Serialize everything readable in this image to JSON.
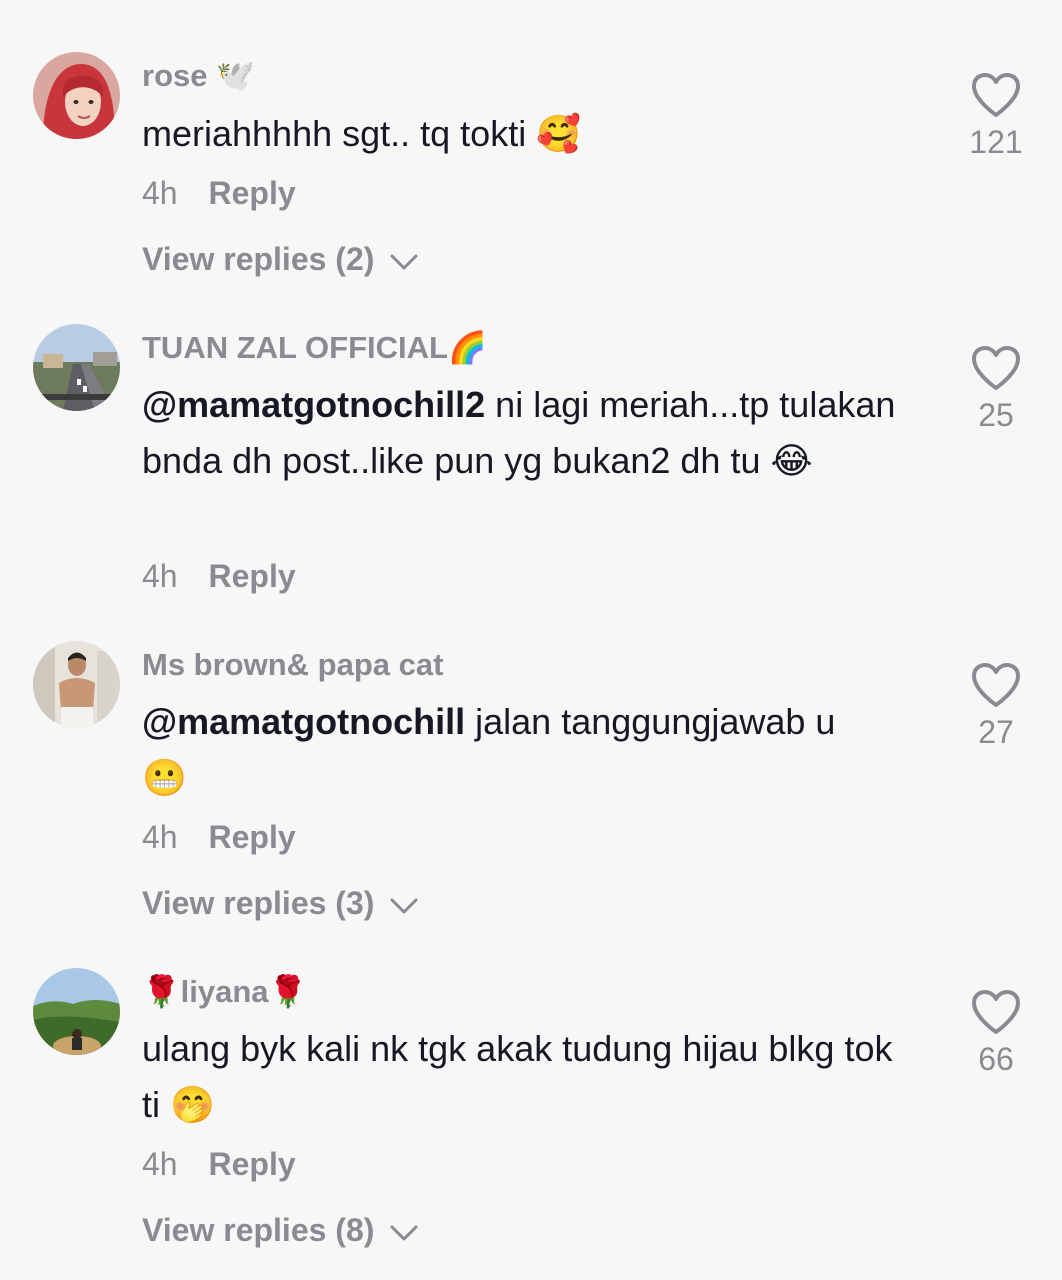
{
  "comments": [
    {
      "username": "rose",
      "username_emoji": "🕊️",
      "mention": "",
      "text": "meriahhhhh sgt.. tq tokti",
      "text_emoji": "🥰",
      "time": "4h",
      "reply_label": "Reply",
      "view_replies": "View replies (2)",
      "likes": "121",
      "avatar_icon": "hijab-portrait"
    },
    {
      "username": "TUAN ZAL OFFICIAL",
      "username_emoji": "🌈",
      "mention": "@mamatgotnochill2",
      "text": "ni lagi meriah...tp tulakan bnda dh post..like pun yg bukan2 dh tu",
      "text_emoji": "😂",
      "time": "4h",
      "reply_label": "Reply",
      "view_replies": "",
      "likes": "25",
      "avatar_icon": "highway-photo"
    },
    {
      "username": "Ms brown& papa cat",
      "username_emoji": "",
      "mention": "@mamatgotnochill",
      "text": "jalan tanggungjawab u",
      "text_emoji": "😬",
      "time": "4h",
      "reply_label": "Reply",
      "view_replies": "View replies (3)",
      "likes": "27",
      "avatar_icon": "man-portrait"
    },
    {
      "username": "liyana",
      "username_prefix_emoji": "🌹",
      "username_emoji": "🌹",
      "mention": "",
      "text": "ulang byk kali nk tgk akak tudung hijau blkg tok ti",
      "text_emoji": "🤭",
      "time": "4h",
      "reply_label": "Reply",
      "view_replies": "View replies (8)",
      "likes": "66",
      "avatar_icon": "landscape-photo"
    }
  ],
  "colors": {
    "background": "#f7f7f7",
    "primary_text": "#161823",
    "secondary_text": "#8a8b91"
  }
}
